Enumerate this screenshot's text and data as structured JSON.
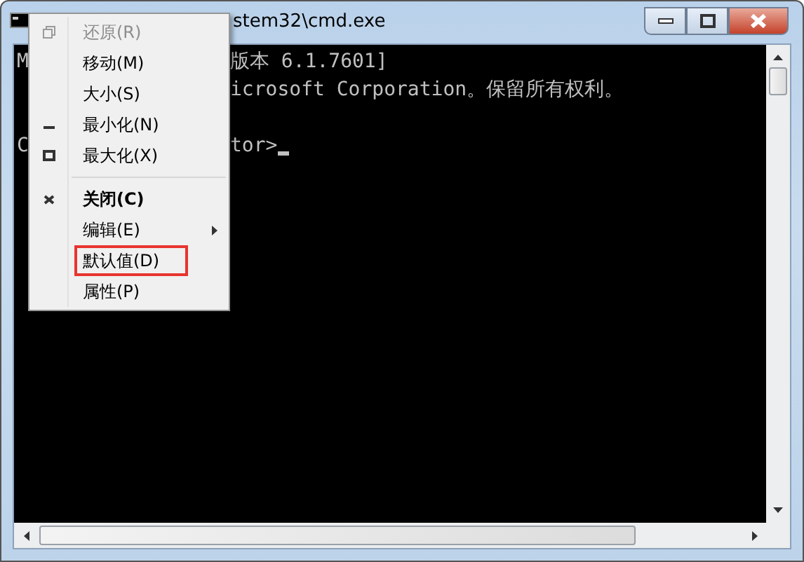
{
  "window": {
    "title": "stem32\\cmd.exe"
  },
  "console": {
    "lines": [
      {
        "kind": "text",
        "left": "M",
        "right": "版本 6.1.7601]"
      },
      {
        "kind": "text",
        "right": "icrosoft Corporation。保留所有权利。"
      },
      {
        "kind": "blank"
      },
      {
        "kind": "text",
        "left": "C",
        "right": "tor>"
      }
    ]
  },
  "system_menu": {
    "items": [
      {
        "kind": "item",
        "label": "还原(R)",
        "disabled": true,
        "default": false,
        "submenu": false,
        "highlighted": false
      },
      {
        "kind": "item",
        "label": "移动(M)",
        "disabled": false,
        "default": false,
        "submenu": false,
        "highlighted": false
      },
      {
        "kind": "item",
        "label": "大小(S)",
        "disabled": false,
        "default": false,
        "submenu": false,
        "highlighted": false
      },
      {
        "kind": "item",
        "label": "最小化(N)",
        "disabled": false,
        "default": false,
        "submenu": false,
        "highlighted": false
      },
      {
        "kind": "item",
        "label": "最大化(X)",
        "disabled": false,
        "default": false,
        "submenu": false,
        "highlighted": false
      },
      {
        "kind": "separator"
      },
      {
        "kind": "item",
        "label": "关闭(C)",
        "disabled": false,
        "default": true,
        "submenu": false,
        "highlighted": false
      },
      {
        "kind": "item",
        "label": "编辑(E)",
        "disabled": false,
        "default": false,
        "submenu": true,
        "highlighted": false
      },
      {
        "kind": "item",
        "label": "默认值(D)",
        "disabled": false,
        "default": false,
        "submenu": false,
        "highlighted": true
      },
      {
        "kind": "item",
        "label": "属性(P)",
        "disabled": false,
        "default": false,
        "submenu": false,
        "highlighted": false
      }
    ]
  }
}
